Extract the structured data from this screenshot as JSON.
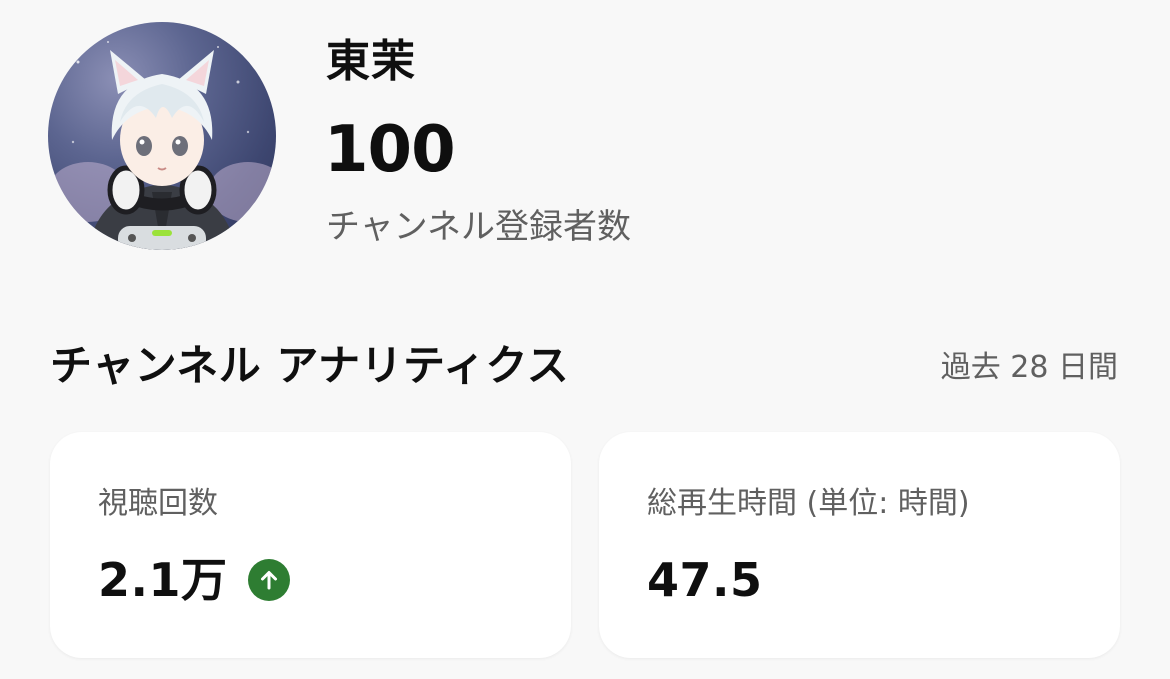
{
  "channel": {
    "name": "東茉",
    "subscriber_count": "100",
    "subscriber_label": "チャンネル登録者数"
  },
  "analytics": {
    "title": "チャンネル アナリティクス",
    "period": "過去 28 日間",
    "cards": [
      {
        "label": "視聴回数",
        "value": "2.1万",
        "trend": "up",
        "trend_icon": "arrow-up-icon",
        "trend_color": "#2e7d32"
      },
      {
        "label": "総再生時間 (単位: 時間)",
        "value": "47.5"
      }
    ]
  },
  "colors": {
    "background": "#f8f8f8",
    "card": "#ffffff",
    "primary_text": "#0f0f0f",
    "secondary_text": "#606060",
    "trend_up": "#2e7d32"
  }
}
